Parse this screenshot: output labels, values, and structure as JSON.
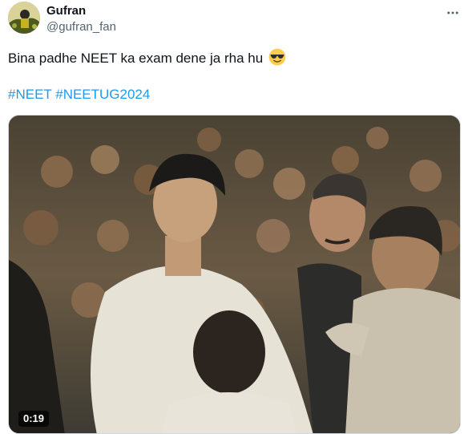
{
  "tweet": {
    "author": {
      "name": "Gufran",
      "handle": "@gufran_fan"
    },
    "text": "Bina padhe NEET ka exam dene ja rha hu",
    "emoji": "smiling-face-with-sunglasses",
    "hashtags": [
      "#NEET",
      "#NEETUG2024"
    ],
    "media": {
      "type": "video",
      "duration": "0:19"
    }
  },
  "icons": {
    "more": "more-horizontal-icon"
  }
}
